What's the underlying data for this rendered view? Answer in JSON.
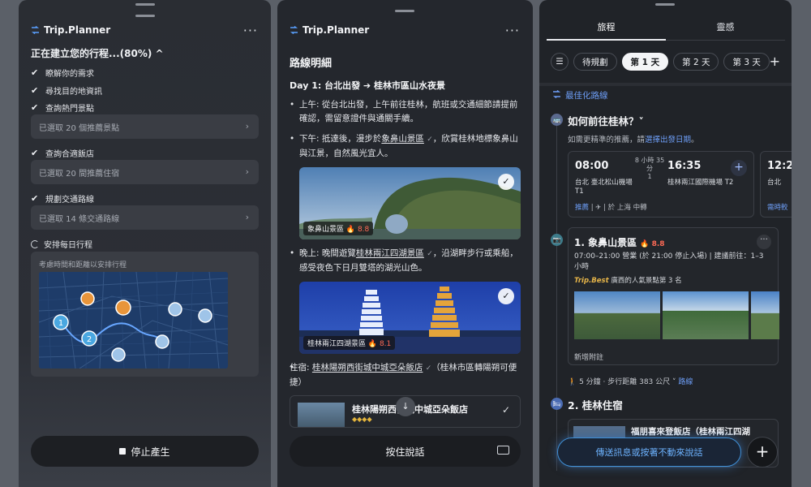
{
  "brand": "Trip.Planner",
  "more": "···",
  "panel1": {
    "title": "正在建立您的行程...(80%) ^",
    "steps": [
      "瞭解你的需求",
      "尋找目的地資訊",
      "查詢熱門景點",
      "查詢合適飯店",
      "規劃交通路線",
      "安排每日行程"
    ],
    "bars": [
      "已選取 20 個推薦景點",
      "已選取 20 間推薦住宿",
      "已選取 14 條交通路線"
    ],
    "map_caption": "考慮時間和距離以安排行程",
    "map_markers": [
      "1",
      "2"
    ],
    "stop_label": "停止產生"
  },
  "panel2": {
    "heading": "路線明細",
    "day": "Day 1: 台北出發 ➔ 桂林市區山水夜景",
    "morning": "上午: 從台北出發，上午前往桂林，航班或交通細節請提前確認，需留意證件與通關手續。",
    "afternoon_pre": "下午: 抵達後，漫步於",
    "afternoon_link": "象鼻山景區",
    "afternoon_post": "，欣賞桂林地標象鼻山與江景，自然風光宜人。",
    "photo1_name": "象鼻山景區",
    "photo1_score": "🔥 8.8",
    "evening_pre": "晚上: 晚間遊覽",
    "evening_link": "桂林兩江四湖景區",
    "evening_post": "，沿湖畔步行或乘船，感受夜色下日月雙塔的湖光山色。",
    "photo2_name": "桂林兩江四湖景區",
    "photo2_score": "🔥 8.1",
    "stay_pre": "住宿: ",
    "stay_link": "桂林陽朔西街城中城亞朵飯店",
    "stay_post": "（桂林市區轉陽朔可便捷）",
    "hotel_name": "桂林陽朔西街城中城亞朵飯店",
    "hotel_diamonds": "◆◆◆◆",
    "talk_label": "按住說話"
  },
  "panel3": {
    "tabs": [
      "旅程",
      "靈感"
    ],
    "chips": [
      "待規劃",
      "第 1 天",
      "第 2 天",
      "第 3 天"
    ],
    "optimize": "最佳化路線",
    "sec1_title": "如何前往桂林？˅",
    "sec1_note_pre": "如需更精準的推薦，請",
    "sec1_note_link": "選擇出發日期",
    "sec1_note_post": "。",
    "flight": {
      "dep": "08:00",
      "arr": "16:35",
      "duration": "8 小時 35 分",
      "stops": "1",
      "dep_airport": "台北 臺北松山機場 T1",
      "arr_airport": "桂林兩江國際機場 T2",
      "meta_link": "推薦",
      "meta_rest": " | ✈ | 於 上海 中轉"
    },
    "flight2": {
      "dep": "12:2",
      "airport": "台北",
      "meta": "需時較"
    },
    "poi": {
      "title": "1. 象鼻山景區",
      "score": "🔥 8.8",
      "hours": "07:00–21:00 營業 (於 21:00 停止入場) | 建議前往：1–3 小時",
      "badge": "Trip.Best",
      "rank": "廣西的人氣景點第 3 名",
      "add_note": "新增附註"
    },
    "walk_pre": "🚶 5 分鐘 · 步行距離 383 公尺 ˅ ",
    "walk_link": "路線",
    "sec2_title": "2. 桂林住宿",
    "hotel_name": "福朋喜來登飯店（桂林兩江四湖",
    "message": "傳送訊息或按著不動來說話",
    "fab": "+"
  }
}
